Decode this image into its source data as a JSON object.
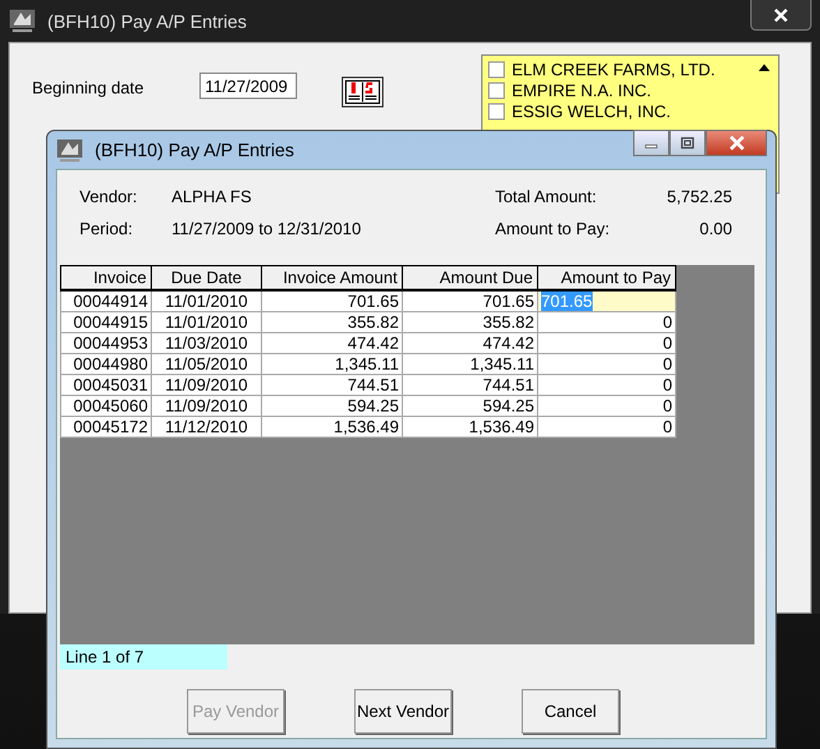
{
  "back_window": {
    "title": "(BFH10)  Pay A/P Entries",
    "beginning_date_label": "Beginning date",
    "beginning_date": "11/27/2009",
    "vendors": [
      {
        "name": "ELM CREEK FARMS, LTD.",
        "checked": false
      },
      {
        "name": "EMPIRE N.A. INC.",
        "checked": false
      },
      {
        "name": "ESSIG WELCH, INC.",
        "checked": false
      }
    ]
  },
  "dialog": {
    "title": "(BFH10)  Pay A/P Entries",
    "vendor_label": "Vendor:",
    "vendor": "ALPHA FS",
    "period_label": "Period:",
    "period": "11/27/2009 to 12/31/2010",
    "total_label": "Total Amount:",
    "total": "5,752.25",
    "to_pay_label": "Amount to Pay:",
    "to_pay": "0.00",
    "table": {
      "columns": [
        "Invoice",
        "Due Date",
        "Invoice Amount",
        "Amount Due",
        "Amount to Pay"
      ],
      "rows": [
        {
          "cells": [
            "00044914",
            "11/01/2010",
            "701.65",
            "701.65",
            "701.65"
          ],
          "selected": true
        },
        {
          "cells": [
            "00044915",
            "11/01/2010",
            "355.82",
            "355.82",
            "0"
          ],
          "selected": false
        },
        {
          "cells": [
            "00044953",
            "11/03/2010",
            "474.42",
            "474.42",
            "0"
          ],
          "selected": false
        },
        {
          "cells": [
            "00044980",
            "11/05/2010",
            "1,345.11",
            "1,345.11",
            "0"
          ],
          "selected": false
        },
        {
          "cells": [
            "00045031",
            "11/09/2010",
            "744.51",
            "744.51",
            "0"
          ],
          "selected": false
        },
        {
          "cells": [
            "00045060",
            "11/09/2010",
            "594.25",
            "594.25",
            "0"
          ],
          "selected": false
        },
        {
          "cells": [
            "00045172",
            "11/12/2010",
            "1,536.49",
            "1,536.49",
            "0"
          ],
          "selected": false
        }
      ]
    },
    "status": "Line 1 of 7",
    "buttons": [
      {
        "label": "Pay Vendor",
        "disabled": true
      },
      {
        "label": "Next Vendor",
        "disabled": false
      },
      {
        "label": "Cancel",
        "disabled": false
      }
    ]
  }
}
